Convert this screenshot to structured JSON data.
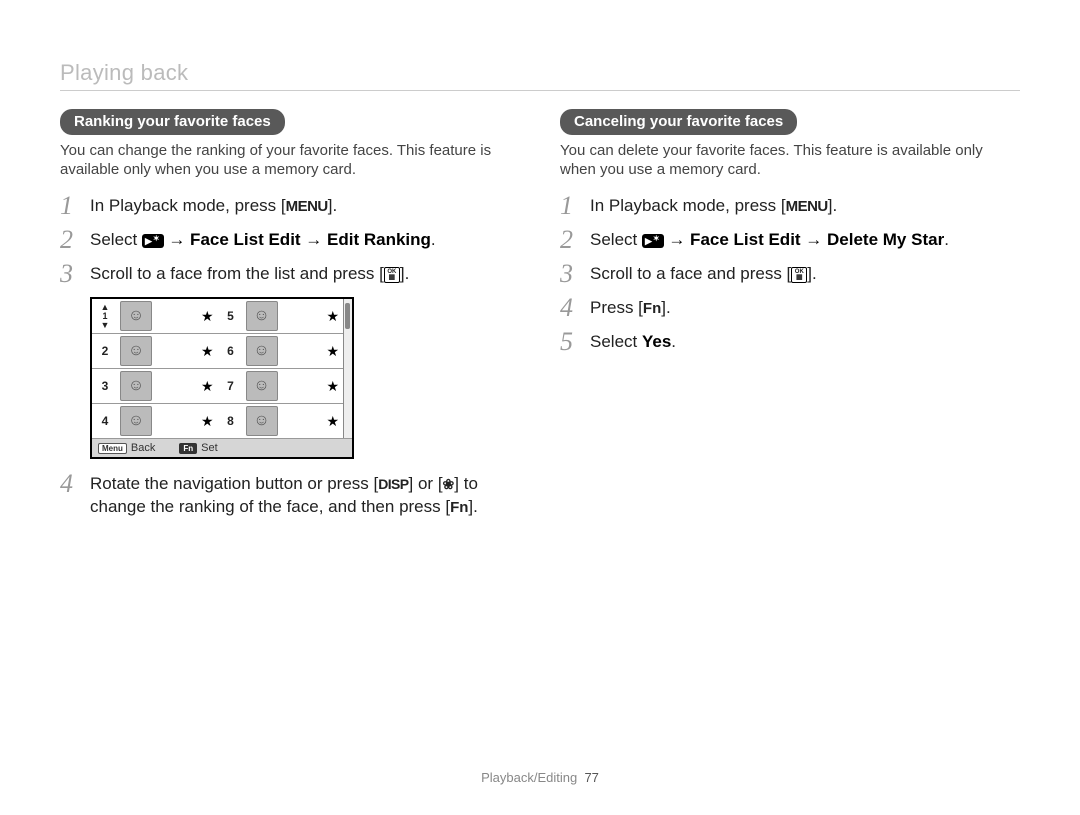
{
  "header": {
    "title": "Playing back"
  },
  "left": {
    "heading": "Ranking your favorite faces",
    "intro": "You can change the ranking of your favorite faces. This feature is available only when you use a memory card.",
    "step1_a": "In Playback mode, press [",
    "step1_b": "].",
    "step2_a": "Select ",
    "step2_b": " → Face List Edit → Edit Ranking",
    "step2_c": ".",
    "step3_a": "Scroll to a face from the list and press [",
    "step3_b": "].",
    "step4_a": "Rotate the navigation button or press [",
    "step4_b": "] or [",
    "step4_c": "] to change the ranking of the face, and then press [",
    "step4_d": "]."
  },
  "right": {
    "heading": "Canceling your favorite faces",
    "intro": "You can delete your favorite faces. This feature is available only when you use a memory card.",
    "step1_a": "In Playback mode, press [",
    "step1_b": "].",
    "step2_a": "Select ",
    "step2_b": " → Face List Edit → Delete My Star",
    "step2_c": ".",
    "step3_a": "Scroll to a face and press [",
    "step3_b": "].",
    "step4_a": "Press [",
    "step4_b": "].",
    "step5_a": "Select ",
    "step5_bold": "Yes",
    "step5_b": "."
  },
  "nums": {
    "n1": "1",
    "n2": "2",
    "n3": "3",
    "n4": "4",
    "n5": "5"
  },
  "icons": {
    "menu": "MENU",
    "disp": "DISP",
    "fn": "Fn"
  },
  "face_ui": {
    "left_col": [
      {
        "n": "1",
        "sel": true
      },
      {
        "n": "2"
      },
      {
        "n": "3"
      },
      {
        "n": "4"
      }
    ],
    "right_col": [
      {
        "n": "5"
      },
      {
        "n": "6"
      },
      {
        "n": "7"
      },
      {
        "n": "8"
      }
    ],
    "footer": {
      "back_key": "Menu",
      "back_label": "Back",
      "set_key": "Fn",
      "set_label": "Set"
    }
  },
  "footer": {
    "section": "Playback/Editing",
    "page": "77"
  }
}
